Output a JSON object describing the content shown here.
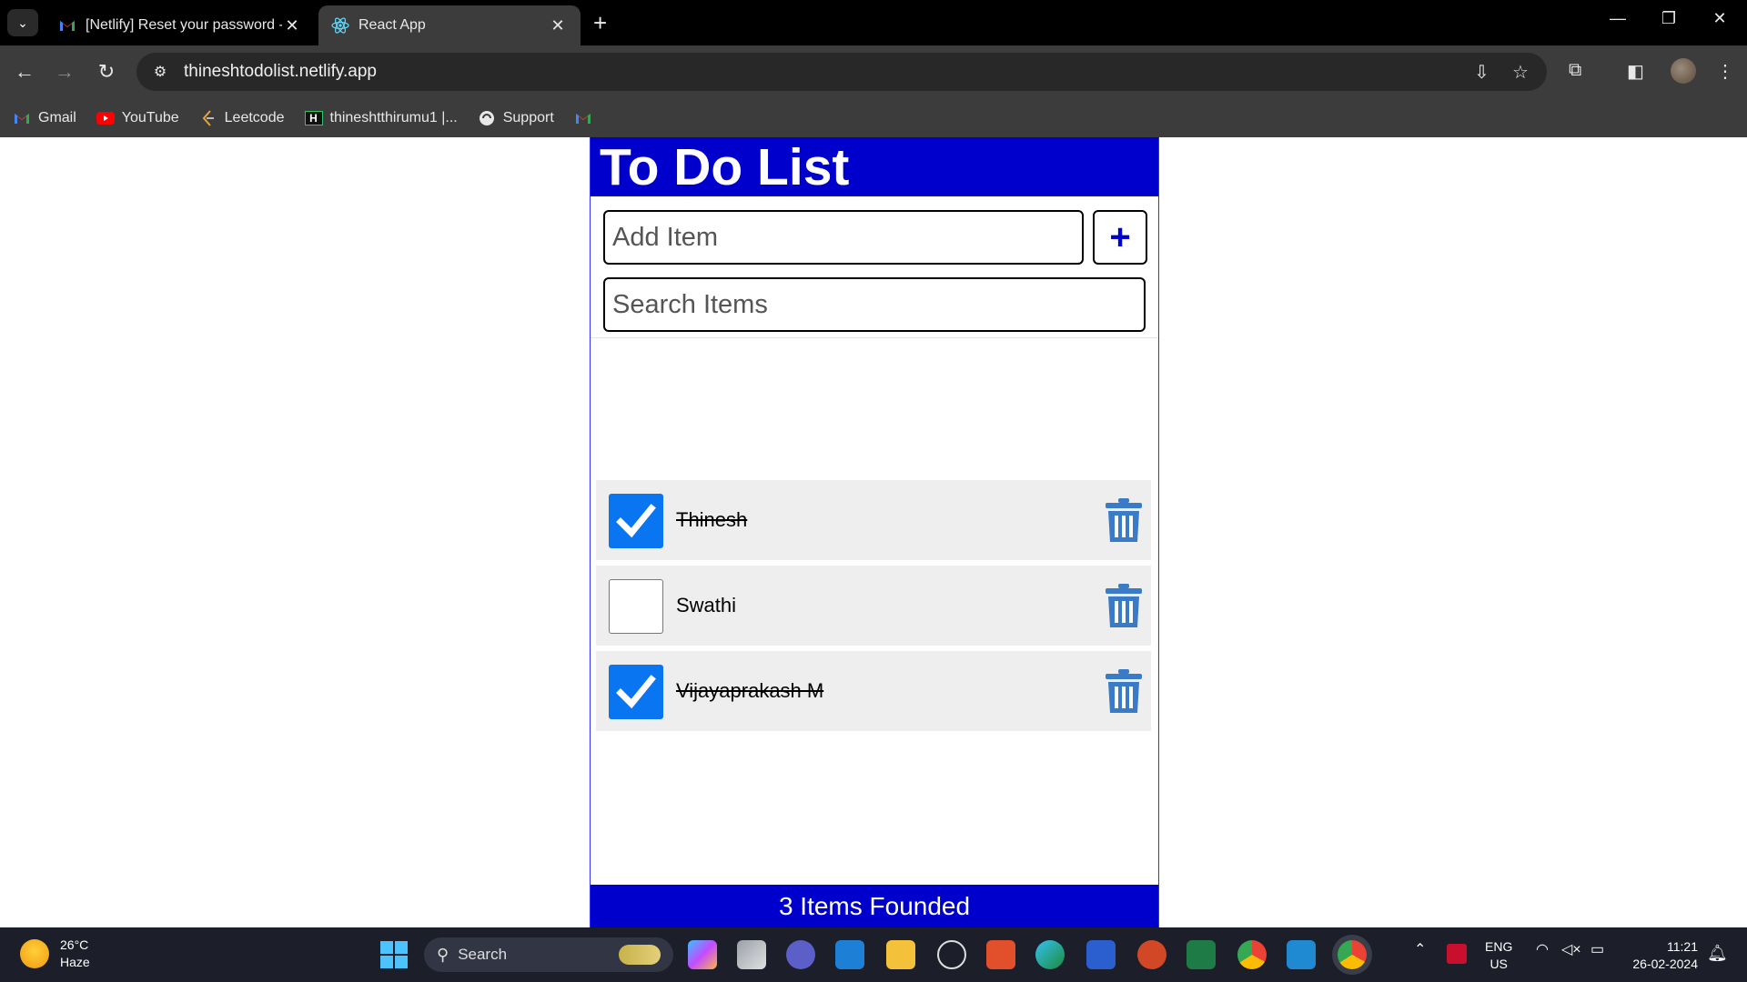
{
  "browser": {
    "tabs": [
      {
        "title": "[Netlify] Reset your password -",
        "icon": "gmail-icon",
        "active": false
      },
      {
        "title": "React App",
        "icon": "react-icon",
        "active": true
      }
    ],
    "url": "thineshtodolist.netlify.app",
    "bookmarks": [
      {
        "label": "Gmail",
        "icon": "gmail-icon"
      },
      {
        "label": "YouTube",
        "icon": "youtube-icon"
      },
      {
        "label": "Leetcode",
        "icon": "leetcode-icon"
      },
      {
        "label": "thineshtthirumu1 |...",
        "icon": "hackerrank-icon"
      },
      {
        "label": "Support",
        "icon": "support-icon"
      },
      {
        "label": "",
        "icon": "gmail-icon"
      }
    ]
  },
  "app": {
    "title": "To Do List",
    "add_placeholder": "Add Item",
    "add_button": "+",
    "search_placeholder": "Search Items",
    "items": [
      {
        "label": "Thinesh",
        "checked": true
      },
      {
        "label": "Swathi",
        "checked": false
      },
      {
        "label": "Vijayaprakash M",
        "checked": true
      }
    ],
    "footer": "3 Items Founded",
    "colors": {
      "header": "#0000cd",
      "checkbox": "#0a75f0",
      "trash": "#3a7bc8"
    }
  },
  "taskbar": {
    "weather_temp": "26°C",
    "weather_desc": "Haze",
    "search_label": "Search",
    "lang_top": "ENG",
    "lang_bottom": "US",
    "time": "11:21",
    "date": "26-02-2024"
  }
}
